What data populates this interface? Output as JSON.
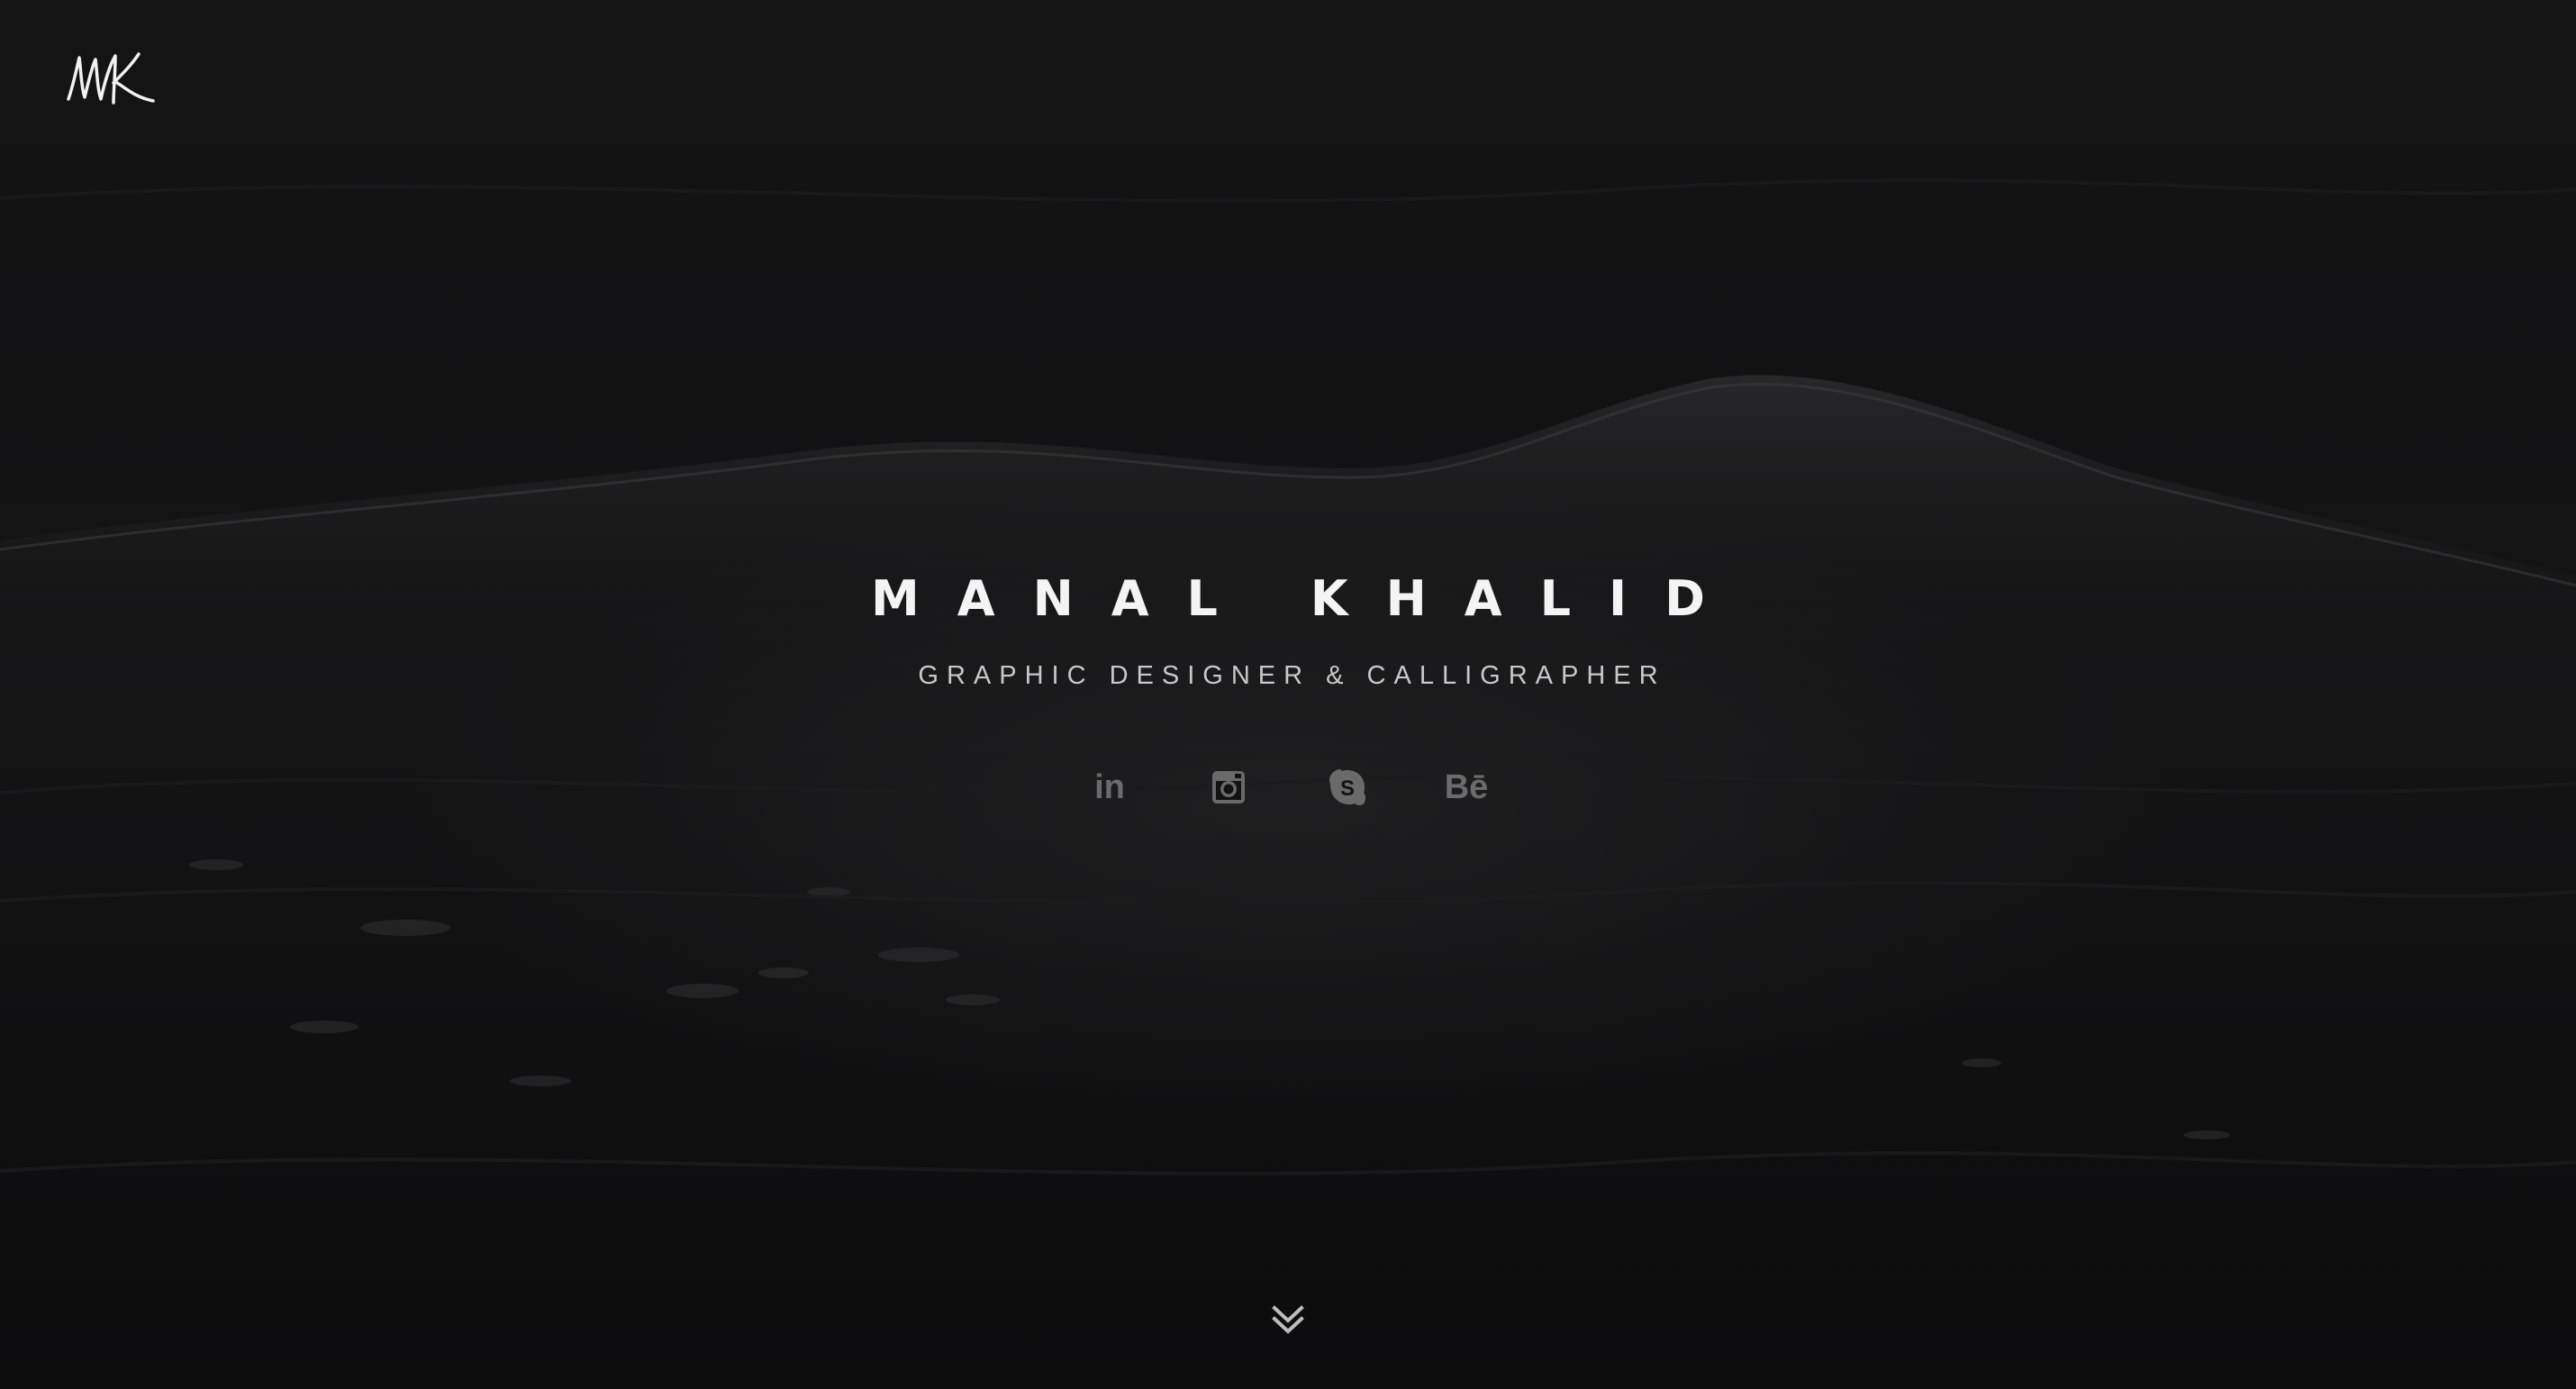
{
  "brand": {
    "logo_text": "MK"
  },
  "hero": {
    "name": "MANAL KHALID",
    "tagline": "GRAPHIC DESIGNER & CALLIGRAPHER"
  },
  "socials": [
    {
      "name": "linkedin",
      "icon": "linkedin-icon",
      "glyph": "in"
    },
    {
      "name": "instagram",
      "icon": "instagram-icon"
    },
    {
      "name": "skype",
      "icon": "skype-icon"
    },
    {
      "name": "behance",
      "icon": "behance-icon",
      "glyph": "Bē"
    }
  ],
  "scroll": {
    "icon": "double-chevron-down-icon"
  },
  "colors": {
    "background": "#111112",
    "heading": "#f4f4f4",
    "tagline": "#c8c8c8",
    "icon": "#6a6a6a"
  }
}
